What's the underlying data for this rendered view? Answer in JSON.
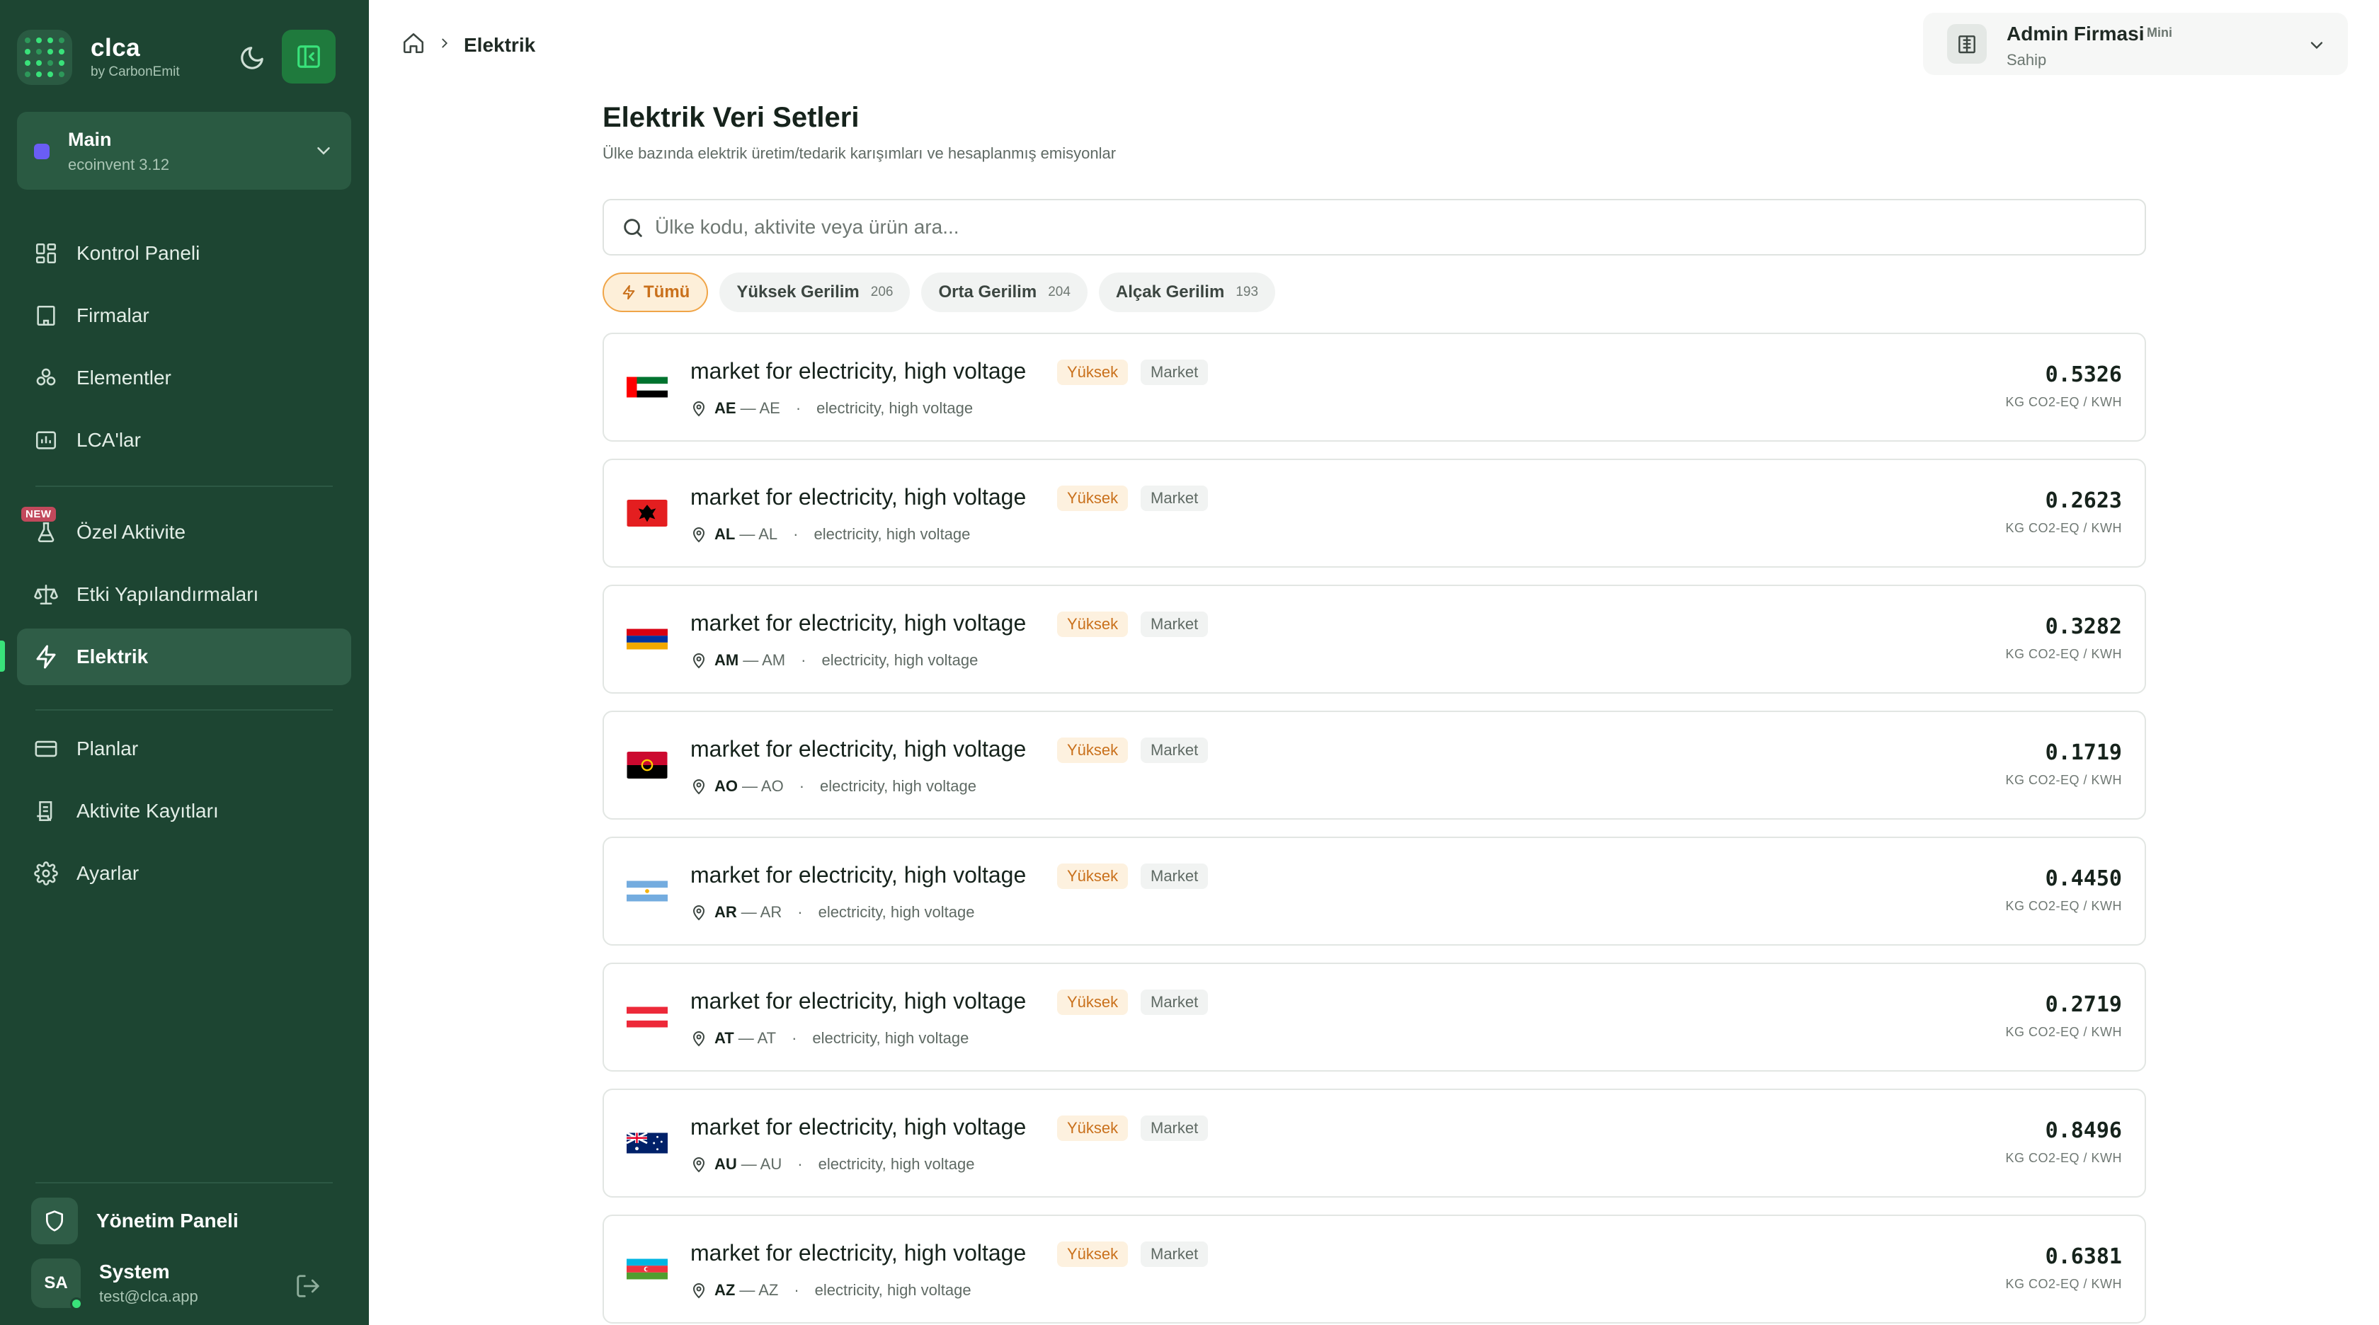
{
  "sidebar": {
    "brand_name": "clca",
    "brand_sub": "by CarbonEmit",
    "workspace": {
      "name": "Main",
      "version": "ecoinvent 3.12",
      "color": "#6a5df5"
    },
    "nav": [
      {
        "label": "Kontrol Paneli",
        "icon": "dashboard-icon"
      },
      {
        "label": "Firmalar",
        "icon": "building-icon"
      },
      {
        "label": "Elementler",
        "icon": "components-icon"
      },
      {
        "label": "LCA'lar",
        "icon": "chart-folder-icon"
      },
      {
        "label": "Özel Aktivite",
        "icon": "flask-icon",
        "badge": "NEW"
      },
      {
        "label": "Etki Yapılandırmaları",
        "icon": "scale-icon"
      },
      {
        "label": "Elektrik",
        "icon": "bolt-icon",
        "active": true
      },
      {
        "label": "Planlar",
        "icon": "credit-card-icon"
      },
      {
        "label": "Aktivite Kayıtları",
        "icon": "log-icon"
      },
      {
        "label": "Ayarlar",
        "icon": "gear-icon"
      }
    ],
    "admin_label": "Yönetim Paneli",
    "user": {
      "initials": "SA",
      "name": "System",
      "email": "test@clca.app"
    },
    "accent": "#39e27a",
    "bg": "#1d4532"
  },
  "header": {
    "breadcrumb_current": "Elektrik",
    "company": {
      "name": "Admin Firmasi",
      "plan": "Mini",
      "role": "Sahip"
    }
  },
  "page": {
    "title": "Elektrik Veri Setleri",
    "subtitle": "Ülke bazında elektrik üretim/tedarik karışımları ve hesaplanmış emisyonlar",
    "search_placeholder": "Ülke kodu, aktivite veya ürün ara...",
    "filters": [
      {
        "label": "Tümü",
        "count": "",
        "active": true
      },
      {
        "label": "Yüksek Gerilim",
        "count": "206"
      },
      {
        "label": "Orta Gerilim",
        "count": "204"
      },
      {
        "label": "Alçak Gerilim",
        "count": "193"
      }
    ]
  },
  "datasets": [
    {
      "title": "market for electricity, high voltage",
      "tag_level": "Yüksek",
      "tag_type": "Market",
      "code": "AE",
      "location": "AE",
      "product": "electricity, high voltage",
      "value": "0.5326",
      "unit": "KG CO2-EQ / KWH",
      "flag": "ae"
    },
    {
      "title": "market for electricity, high voltage",
      "tag_level": "Yüksek",
      "tag_type": "Market",
      "code": "AL",
      "location": "AL",
      "product": "electricity, high voltage",
      "value": "0.2623",
      "unit": "KG CO2-EQ / KWH",
      "flag": "al"
    },
    {
      "title": "market for electricity, high voltage",
      "tag_level": "Yüksek",
      "tag_type": "Market",
      "code": "AM",
      "location": "AM",
      "product": "electricity, high voltage",
      "value": "0.3282",
      "unit": "KG CO2-EQ / KWH",
      "flag": "am"
    },
    {
      "title": "market for electricity, high voltage",
      "tag_level": "Yüksek",
      "tag_type": "Market",
      "code": "AO",
      "location": "AO",
      "product": "electricity, high voltage",
      "value": "0.1719",
      "unit": "KG CO2-EQ / KWH",
      "flag": "ao"
    },
    {
      "title": "market for electricity, high voltage",
      "tag_level": "Yüksek",
      "tag_type": "Market",
      "code": "AR",
      "location": "AR",
      "product": "electricity, high voltage",
      "value": "0.4450",
      "unit": "KG CO2-EQ / KWH",
      "flag": "ar"
    },
    {
      "title": "market for electricity, high voltage",
      "tag_level": "Yüksek",
      "tag_type": "Market",
      "code": "AT",
      "location": "AT",
      "product": "electricity, high voltage",
      "value": "0.2719",
      "unit": "KG CO2-EQ / KWH",
      "flag": "at"
    },
    {
      "title": "market for electricity, high voltage",
      "tag_level": "Yüksek",
      "tag_type": "Market",
      "code": "AU",
      "location": "AU",
      "product": "electricity, high voltage",
      "value": "0.8496",
      "unit": "KG CO2-EQ / KWH",
      "flag": "au"
    },
    {
      "title": "market for electricity, high voltage",
      "tag_level": "Yüksek",
      "tag_type": "Market",
      "code": "AZ",
      "location": "AZ",
      "product": "electricity, high voltage",
      "value": "0.6381",
      "unit": "KG CO2-EQ / KWH",
      "flag": "az"
    }
  ]
}
